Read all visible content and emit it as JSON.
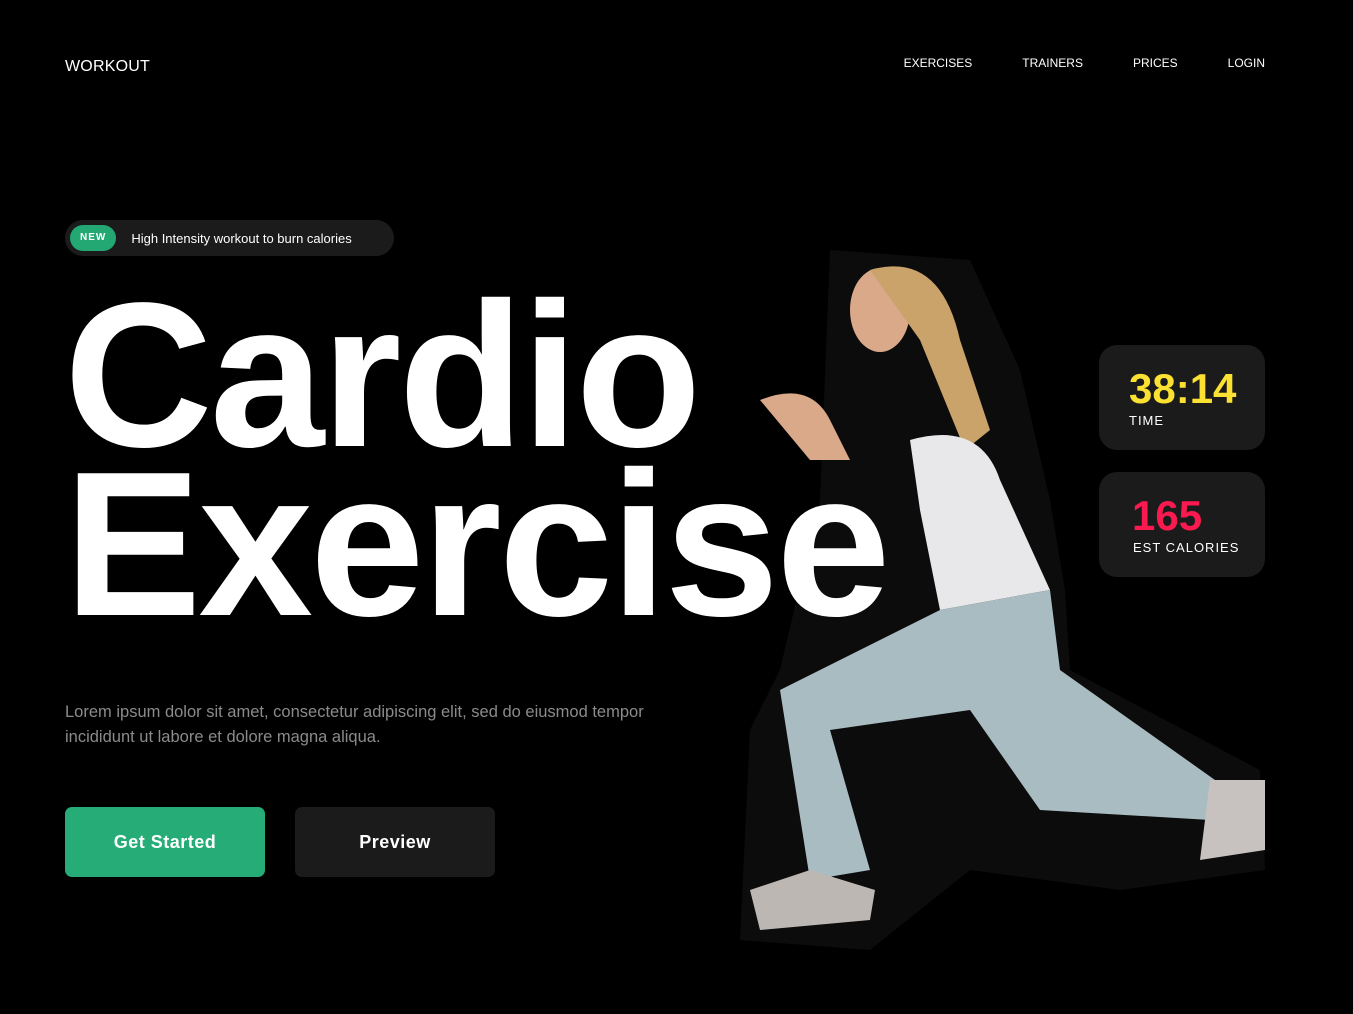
{
  "header": {
    "logo": "WORKOUT",
    "nav": [
      "EXERCISES",
      "TRAINERS",
      "PRICES",
      "LOGIN"
    ]
  },
  "hero": {
    "badge": "NEW",
    "tagline": "High Intensity workout to burn calories",
    "title_line1": "Cardio",
    "title_line2": "Exercise",
    "description": "Lorem ipsum dolor sit amet, consectetur adipiscing elit, sed do eiusmod tempor incididunt ut labore et dolore magna aliqua.",
    "primary_button": "Get Started",
    "secondary_button": "Preview"
  },
  "stats": [
    {
      "value": "38:14",
      "label": "TIME"
    },
    {
      "value": "165",
      "label": "EST CALORIES"
    }
  ],
  "colors": {
    "accent": "#26ad77",
    "time": "#fbe132",
    "calories": "#fb1a50",
    "card": "#1b1b1b"
  }
}
